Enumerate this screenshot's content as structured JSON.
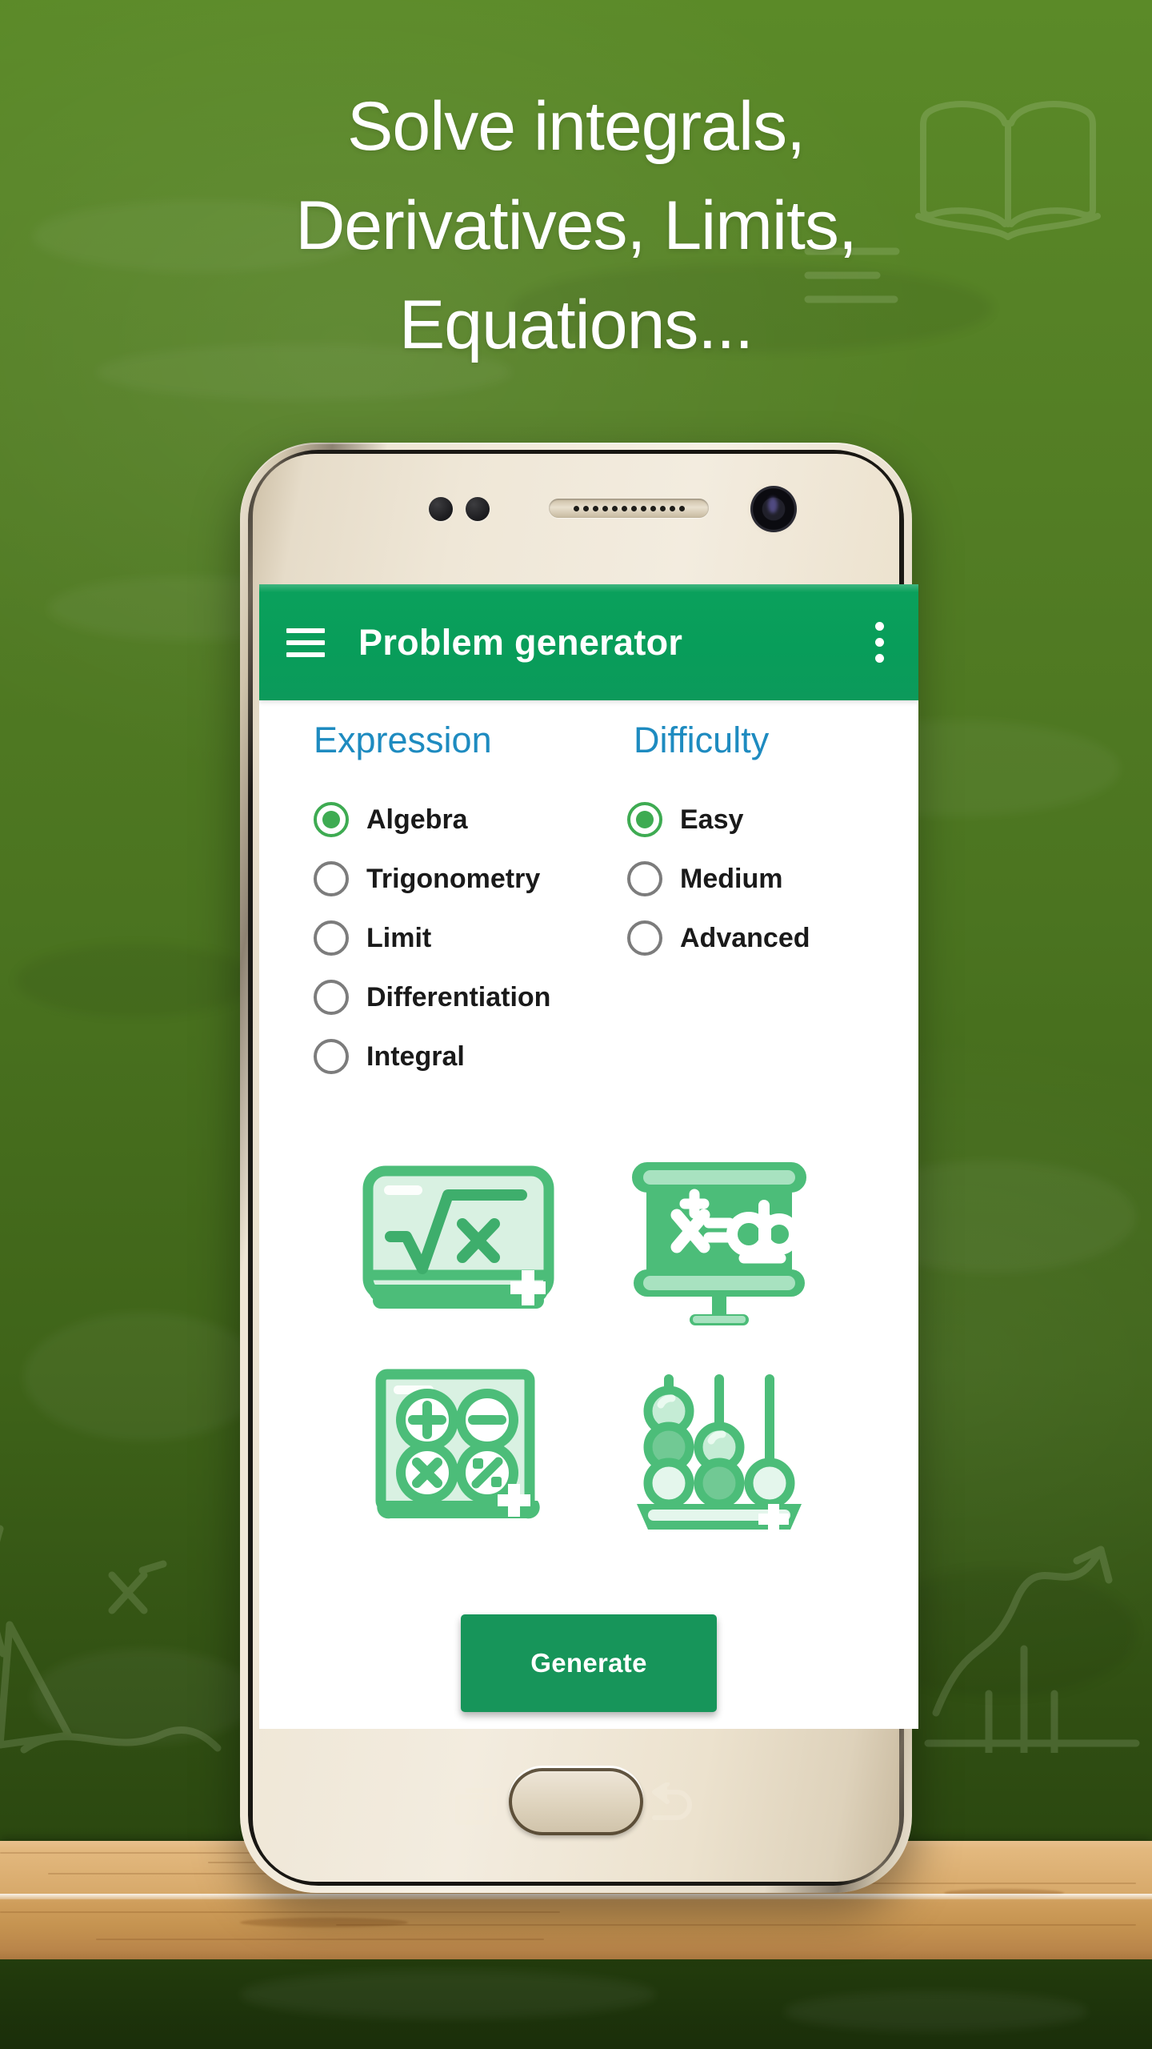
{
  "promo": {
    "headline_lines": [
      "Solve integrals,",
      "Derivatives, Limits,",
      "Equations..."
    ],
    "background_color": "#4e7a22",
    "headline_color": "#ffffff"
  },
  "device": {
    "frame_color": "#efe7d7",
    "hardware": {
      "earpiece": "earpiece-speaker",
      "camera": "front-camera",
      "sensor_left": "proximity-sensor",
      "sensor_right": "light-sensor",
      "home_button": "home-button",
      "recents_button": "recents-button",
      "back_button": "back-button"
    }
  },
  "app": {
    "accent_color": "#089d5a",
    "section_title_color": "#1e8bc0",
    "radio_selected_color": "#3eab52",
    "appbar": {
      "title": "Problem generator",
      "menu_icon": "hamburger-menu-icon",
      "overflow_icon": "overflow-menu-icon"
    },
    "expression": {
      "title": "Expression",
      "options": [
        {
          "label": "Algebra",
          "selected": true
        },
        {
          "label": "Trigonometry",
          "selected": false
        },
        {
          "label": "Limit",
          "selected": false
        },
        {
          "label": "Differentiation",
          "selected": false
        },
        {
          "label": "Integral",
          "selected": false
        }
      ]
    },
    "difficulty": {
      "title": "Difficulty",
      "options": [
        {
          "label": "Easy",
          "selected": true
        },
        {
          "label": "Medium",
          "selected": false
        },
        {
          "label": "Advanced",
          "selected": false
        }
      ]
    },
    "illustrations": [
      {
        "name": "square-root-board-icon",
        "text": "√x"
      },
      {
        "name": "blackboard-formula-icon",
        "text": "x=ab"
      },
      {
        "name": "calculator-icon",
        "text": "+ − × %"
      },
      {
        "name": "abacus-icon",
        "text": ""
      }
    ],
    "generate_button": {
      "label": "Generate",
      "color": "#17955a"
    }
  }
}
